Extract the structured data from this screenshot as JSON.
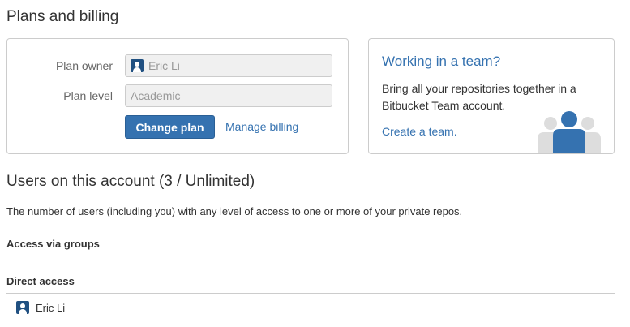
{
  "page": {
    "title": "Plans and billing"
  },
  "plan": {
    "owner_label": "Plan owner",
    "owner_value": "Eric Li",
    "level_label": "Plan level",
    "level_value": "Academic",
    "change_plan_label": "Change plan",
    "manage_billing_label": "Manage billing"
  },
  "team_promo": {
    "title": "Working in a team?",
    "body": "Bring all your repositories together in a Bitbucket Team account.",
    "link_label": "Create a team.",
    "icons": [
      "team-people-icon"
    ]
  },
  "users": {
    "title": "Users on this account (3 / Unlimited)",
    "description": "The number of users (including you) with any level of access to one or more of your private repos.",
    "groups_heading": "Access via groups",
    "direct_heading": "Direct access",
    "direct_users": [
      {
        "name": "Eric Li",
        "icon": "user-avatar-icon"
      }
    ]
  },
  "colors": {
    "accent": "#3572b0",
    "border": "#cccccc",
    "field_bg": "#f0f0f0",
    "illustration_front": "#3572b0",
    "illustration_back": "#dddddd"
  }
}
